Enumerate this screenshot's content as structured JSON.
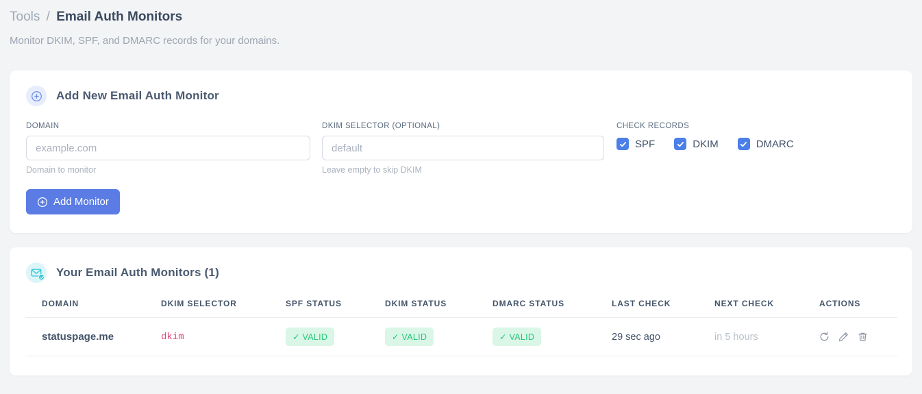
{
  "colors": {
    "accent_blue": "#5a7ce4",
    "checkbox_blue": "#4c80e8",
    "icon_badge_blue_bg": "#e7edfc",
    "icon_cyan": "#29c3d6",
    "icon_badge_cyan_bg": "#dcf5f8",
    "valid_text_green": "#29c87a",
    "valid_bg_green": "#d9f6e7",
    "code_pink": "#e8437b",
    "page_bg": "#f3f4f6"
  },
  "breadcrumb": {
    "section": "Tools",
    "separator": "/",
    "page": "Email Auth Monitors"
  },
  "subtitle": "Monitor DKIM, SPF, and DMARC records for your domains.",
  "add_card": {
    "title": "Add New Email Auth Monitor",
    "domain_field": {
      "label": "DOMAIN",
      "placeholder": "example.com",
      "value": "",
      "help": "Domain to monitor"
    },
    "selector_field": {
      "label": "DKIM SELECTOR (OPTIONAL)",
      "placeholder": "default",
      "value": "",
      "help": "Leave empty to skip DKIM"
    },
    "check_records": {
      "label": "CHECK RECORDS",
      "options": [
        {
          "label": "SPF",
          "checked": true
        },
        {
          "label": "DKIM",
          "checked": true
        },
        {
          "label": "DMARC",
          "checked": true
        }
      ]
    },
    "submit_label": "Add Monitor"
  },
  "monitors_card": {
    "title": "Your Email Auth Monitors (1)",
    "table": {
      "headers": [
        "DOMAIN",
        "DKIM SELECTOR",
        "SPF STATUS",
        "DKIM STATUS",
        "DMARC STATUS",
        "LAST CHECK",
        "NEXT CHECK",
        "ACTIONS"
      ],
      "rows": [
        {
          "domain": "statuspage.me",
          "dkim_selector": "dkim",
          "spf_status": "✓ VALID",
          "dkim_status": "✓ VALID",
          "dmarc_status": "✓ VALID",
          "last_check": "29 sec ago",
          "next_check": "in 5 hours"
        }
      ]
    }
  }
}
